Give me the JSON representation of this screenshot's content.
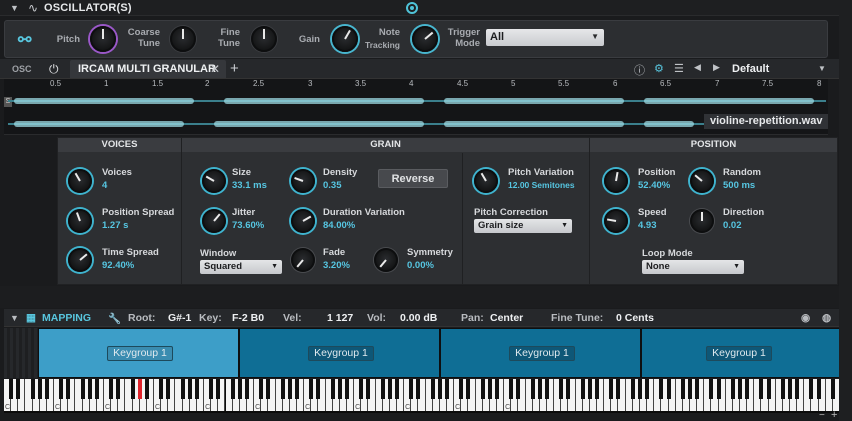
{
  "header": {
    "title": "OSCILLATOR(S)"
  },
  "osc_controls": {
    "pitch": "Pitch",
    "coarse": "Coarse\nTune",
    "fine": "Fine\nTune",
    "gain": "Gain",
    "note": "Note",
    "tracking": "Tracking",
    "trigger": "Trigger\nMode",
    "trigger_value": "All"
  },
  "tabrow": {
    "osc_label": "OSC",
    "tab_name": "IRCAM MULTI GRANULAR",
    "preset": "Default"
  },
  "waveform": {
    "ticks": [
      "0.5",
      "1",
      "1.5",
      "2",
      "2.5",
      "3",
      "3.5",
      "4",
      "4.5",
      "5",
      "5.5",
      "6",
      "6.5",
      "7",
      "7.5",
      "8"
    ],
    "filename": "violine-repetition.wav"
  },
  "voices": {
    "title": "VOICES",
    "voices_label": "Voices",
    "voices_value": "4",
    "posspread_label": "Position Spread",
    "posspread_value": "1.27 s",
    "timespread_label": "Time Spread",
    "timespread_value": "92.40%"
  },
  "grain": {
    "title": "GRAIN",
    "size_label": "Size",
    "size_value": "33.1 ms",
    "density_label": "Density",
    "density_value": "0.35",
    "reverse_label": "Reverse",
    "jitter_label": "Jitter",
    "jitter_value": "73.60%",
    "durvar_label": "Duration Variation",
    "durvar_value": "84.00%",
    "window_label": "Window",
    "window_value": "Squared",
    "fade_label": "Fade",
    "fade_value": "3.20%",
    "symmetry_label": "Symmetry",
    "symmetry_value": "0.00%",
    "pitchvar_label": "Pitch Variation",
    "pitchvar_value": "12.00 Semitones",
    "pitchcorr_label": "Pitch Correction",
    "pitchcorr_value": "Grain size"
  },
  "position": {
    "title": "POSITION",
    "position_label": "Position",
    "position_value": "52.40%",
    "random_label": "Random",
    "random_value": "500 ms",
    "speed_label": "Speed",
    "speed_value": "4.93",
    "direction_label": "Direction",
    "direction_value": "0.02",
    "loop_label": "Loop Mode",
    "loop_value": "None"
  },
  "mapping": {
    "title": "MAPPING",
    "root_label": "Root:",
    "root_value": "G#-1",
    "key_label": "Key:",
    "key_value": "F-2 B0",
    "vel_label": "Vel:",
    "vel_value": "1 127",
    "vol_label": "Vol:",
    "vol_value": "0.00 dB",
    "pan_label": "Pan:",
    "pan_value": "Center",
    "finetune_label": "Fine Tune:",
    "finetune_value": "0 Cents",
    "keygroups": [
      "Keygroup 1",
      "Keygroup 1",
      "Keygroup 1",
      "Keygroup 1"
    ]
  },
  "keyboard": {
    "octave_labels": [
      "C-1",
      "C0",
      "C1",
      "C2",
      "C3",
      "C4",
      "C5",
      "C6",
      "C7",
      "C8",
      "C9"
    ]
  }
}
